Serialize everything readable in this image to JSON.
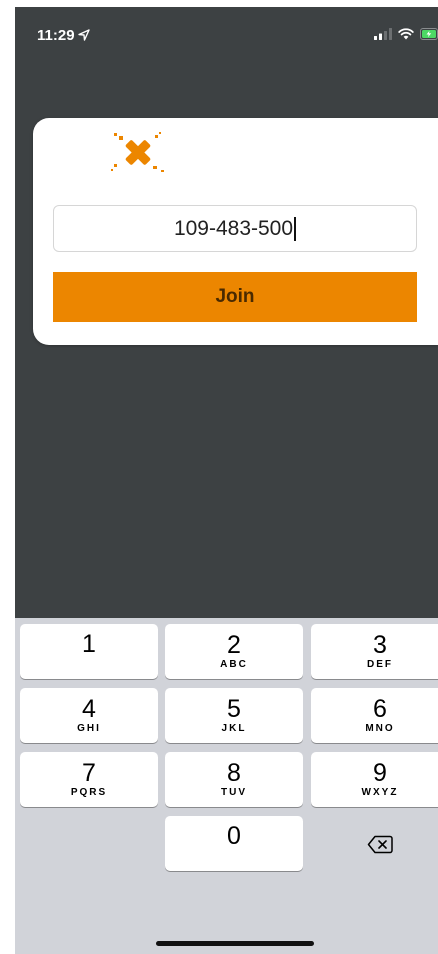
{
  "status_bar": {
    "time": "11:29",
    "icons": [
      "location-arrow-icon",
      "signal-icon",
      "wifi-icon",
      "battery-charging-icon"
    ]
  },
  "colors": {
    "accent": "#ec8600",
    "app_background": "#3d4143",
    "keypad_background": "#d1d3d9"
  },
  "card": {
    "logo_icon": "x-logo-icon",
    "code_value": "109-483-500",
    "join_label": "Join"
  },
  "keypad": {
    "keys": [
      {
        "digit": "1",
        "letters": ""
      },
      {
        "digit": "2",
        "letters": "ABC"
      },
      {
        "digit": "3",
        "letters": "DEF"
      },
      {
        "digit": "4",
        "letters": "GHI"
      },
      {
        "digit": "5",
        "letters": "JKL"
      },
      {
        "digit": "6",
        "letters": "MNO"
      },
      {
        "digit": "7",
        "letters": "PQRS"
      },
      {
        "digit": "8",
        "letters": "TUV"
      },
      {
        "digit": "9",
        "letters": "WXYZ"
      },
      {
        "digit": "0",
        "letters": ""
      }
    ],
    "delete_icon": "backspace-icon"
  }
}
